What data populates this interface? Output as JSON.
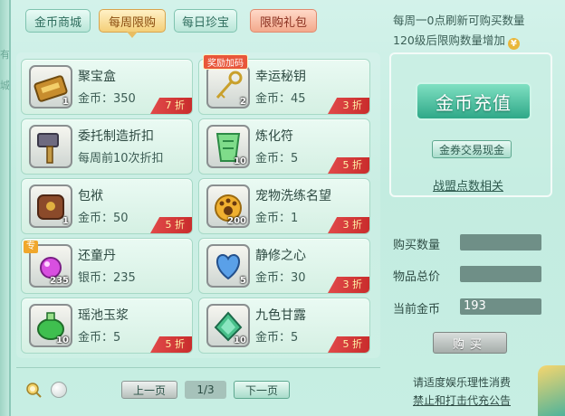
{
  "tabs": [
    {
      "label": "金币商城"
    },
    {
      "label": "每周限购"
    },
    {
      "label": "每日珍宝"
    },
    {
      "label": "限购礼包"
    }
  ],
  "info": {
    "line1": "每周一0点刷新可购买数量",
    "line2": "120级后限购数量增加",
    "coin_badge": "¥"
  },
  "items": [
    {
      "name": "聚宝盒",
      "price_label": "金币：",
      "price": "350",
      "count": "1",
      "discount": "7 折",
      "icon": "treasure-box-icon"
    },
    {
      "name": "幸运秘钥",
      "price_label": "金币：",
      "price": "45",
      "count": "2",
      "discount": "3 折",
      "icon": "key-icon",
      "tag": "奖励加码"
    },
    {
      "name": "委托制造折扣",
      "price_label": "",
      "price": "每周前10次折扣",
      "count": "",
      "discount": "",
      "icon": "hammer-icon"
    },
    {
      "name": "炼化符",
      "price_label": "金币：",
      "price": "5",
      "count": "10",
      "discount": "5 折",
      "icon": "talisman-icon"
    },
    {
      "name": "包袱",
      "price_label": "金币：",
      "price": "50",
      "count": "1",
      "discount": "5 折",
      "icon": "bag-icon"
    },
    {
      "name": "宠物洗练名望",
      "price_label": "金币：",
      "price": "1",
      "count": "200",
      "discount": "3 折",
      "icon": "paw-icon"
    },
    {
      "name": "还童丹",
      "price_label": "银币：",
      "price": "235",
      "count": "235",
      "discount": "",
      "icon": "pill-icon",
      "tag": "专"
    },
    {
      "name": "静修之心",
      "price_label": "金币：",
      "price": "30",
      "count": "5",
      "discount": "3 折",
      "icon": "heart-icon"
    },
    {
      "name": "瑶池玉浆",
      "price_label": "金币：",
      "price": "5",
      "count": "10",
      "discount": "5 折",
      "icon": "jade-potion-icon"
    },
    {
      "name": "九色甘露",
      "price_label": "金币：",
      "price": "5",
      "count": "10",
      "discount": "5 折",
      "icon": "dew-gem-icon"
    }
  ],
  "right": {
    "recharge": "金币充值",
    "exchange": "金券交易现金",
    "alliance": "战盟点数相关",
    "buy_qty_label": "购买数量",
    "buy_qty_value": "",
    "total_label": "物品总价",
    "total_value": "",
    "current_label": "当前金币",
    "current_value": "193",
    "buy_btn": "购买"
  },
  "pager": {
    "prev": "上一页",
    "page": "1/3",
    "next": "下一页"
  },
  "footer": {
    "line1": "请适度娱乐理性消费",
    "line2": "禁止和打击代充公告"
  },
  "colors": {
    "accent": "#2fa888",
    "discount": "#d93a3a",
    "active_tab": "#f4cf78"
  }
}
